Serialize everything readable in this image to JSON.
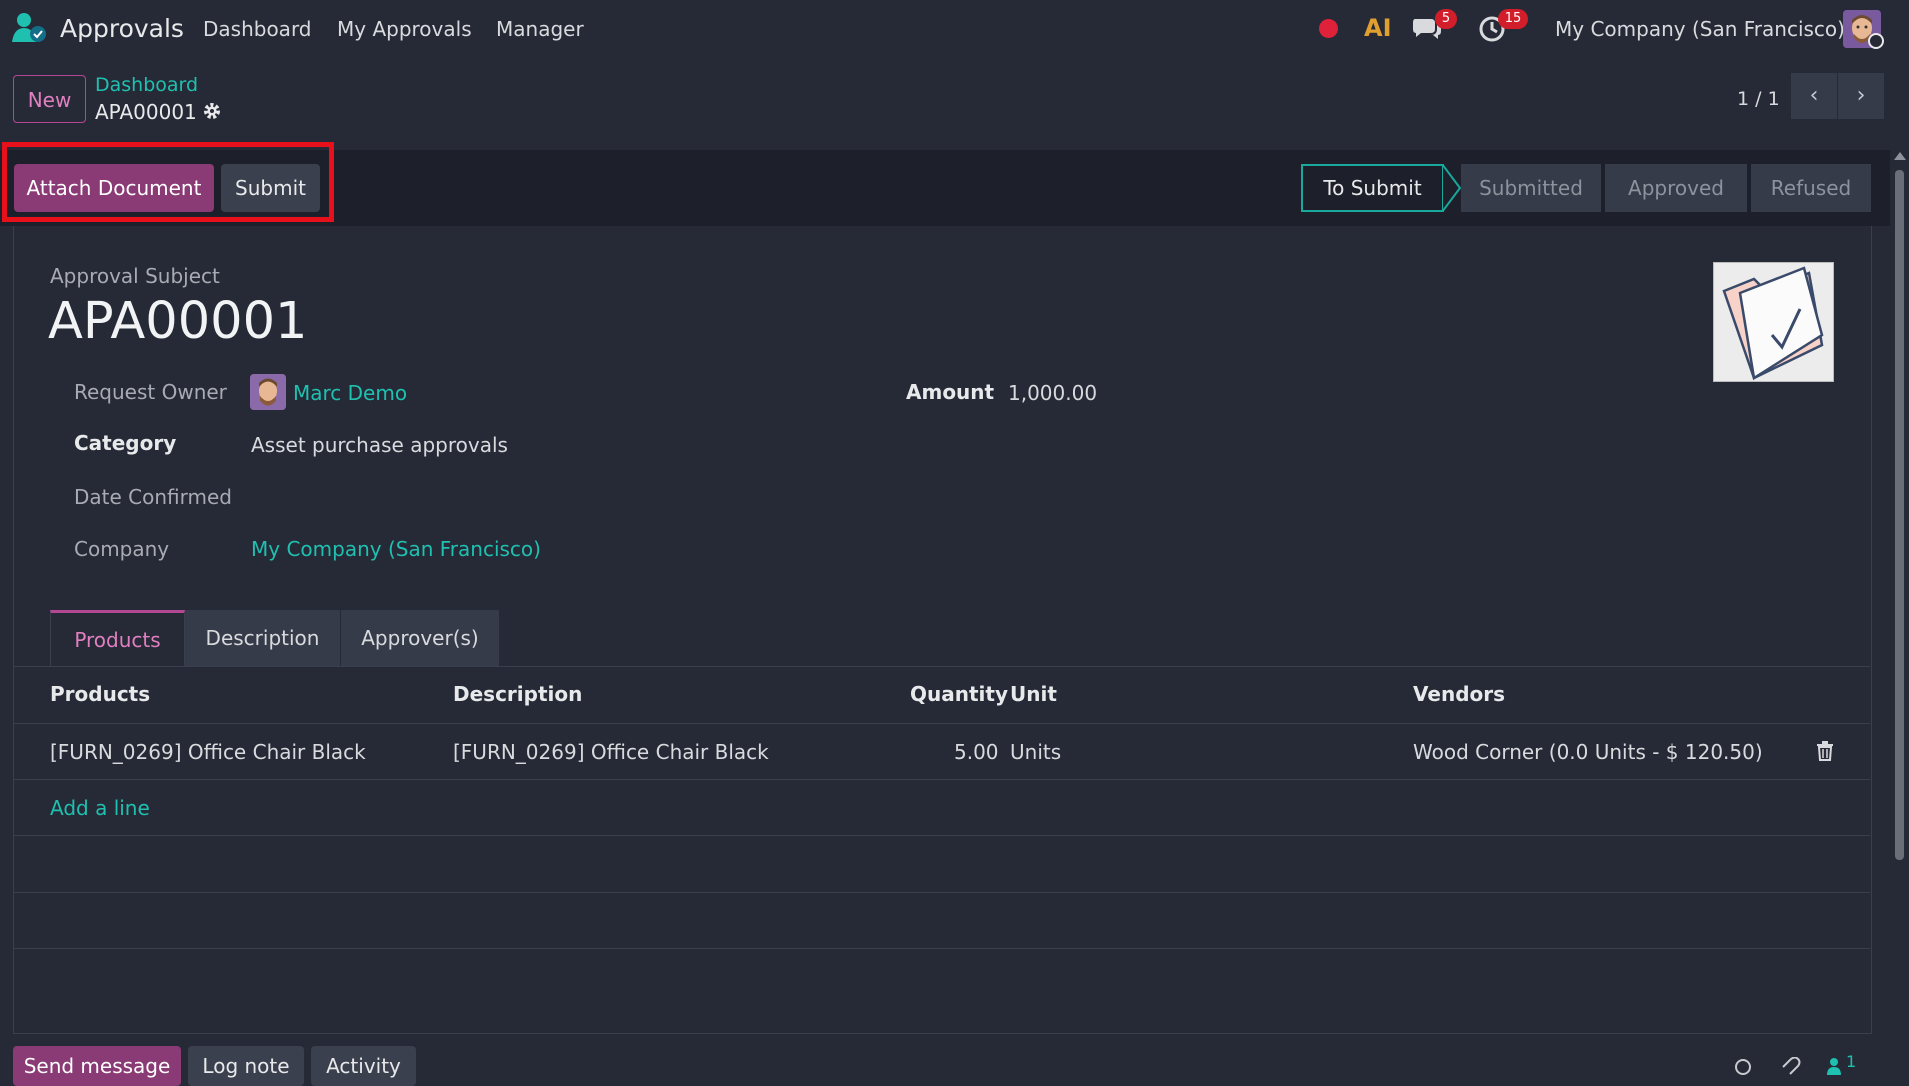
{
  "navbar": {
    "app_name": "Approvals",
    "menu": [
      "Dashboard",
      "My Approvals",
      "Manager"
    ],
    "ai_label": "AI",
    "chat_count": "5",
    "activity_count": "15",
    "company": "My Company (San Francisco)"
  },
  "control_panel": {
    "new_label": "New",
    "breadcrumb_parent": "Dashboard",
    "breadcrumb_current": "APA00001",
    "pager": "1 / 1"
  },
  "statusbar": {
    "attach_label": "Attach Document",
    "submit_label": "Submit",
    "stages": [
      "To Submit",
      "Submitted",
      "Approved",
      "Refused"
    ],
    "active_stage": "To Submit"
  },
  "form": {
    "subject_label": "Approval Subject",
    "subject": "APA00001",
    "fields": {
      "request_owner_label": "Request Owner",
      "request_owner": "Marc Demo",
      "category_label": "Category",
      "category": "Asset purchase approvals",
      "date_confirmed_label": "Date Confirmed",
      "date_confirmed": "",
      "company_label": "Company",
      "company": "My Company (San Francisco)",
      "amount_label": "Amount",
      "amount": "1,000.00"
    }
  },
  "tabs": [
    "Products",
    "Description",
    "Approver(s)"
  ],
  "active_tab": "Products",
  "product_table": {
    "headers": [
      "Products",
      "Description",
      "Quantity",
      "Unit",
      "Vendors"
    ],
    "rows": [
      {
        "product": "[FURN_0269] Office Chair Black",
        "description": "[FURN_0269] Office Chair Black",
        "quantity": "5.00",
        "unit": "Units",
        "vendors": "Wood Corner (0.0 Units - $ 120.50)"
      }
    ],
    "add_line_label": "Add a line"
  },
  "chatter": {
    "send_message_label": "Send message",
    "log_note_label": "Log note",
    "activity_label": "Activity",
    "follower_count": "1"
  },
  "colors": {
    "background": "#262a36",
    "primary": "#8a3a74",
    "link": "#1fc0b0",
    "active_stage_border": "#1aa89c",
    "badge": "#d21e2b",
    "highlight": "#e8101a"
  }
}
